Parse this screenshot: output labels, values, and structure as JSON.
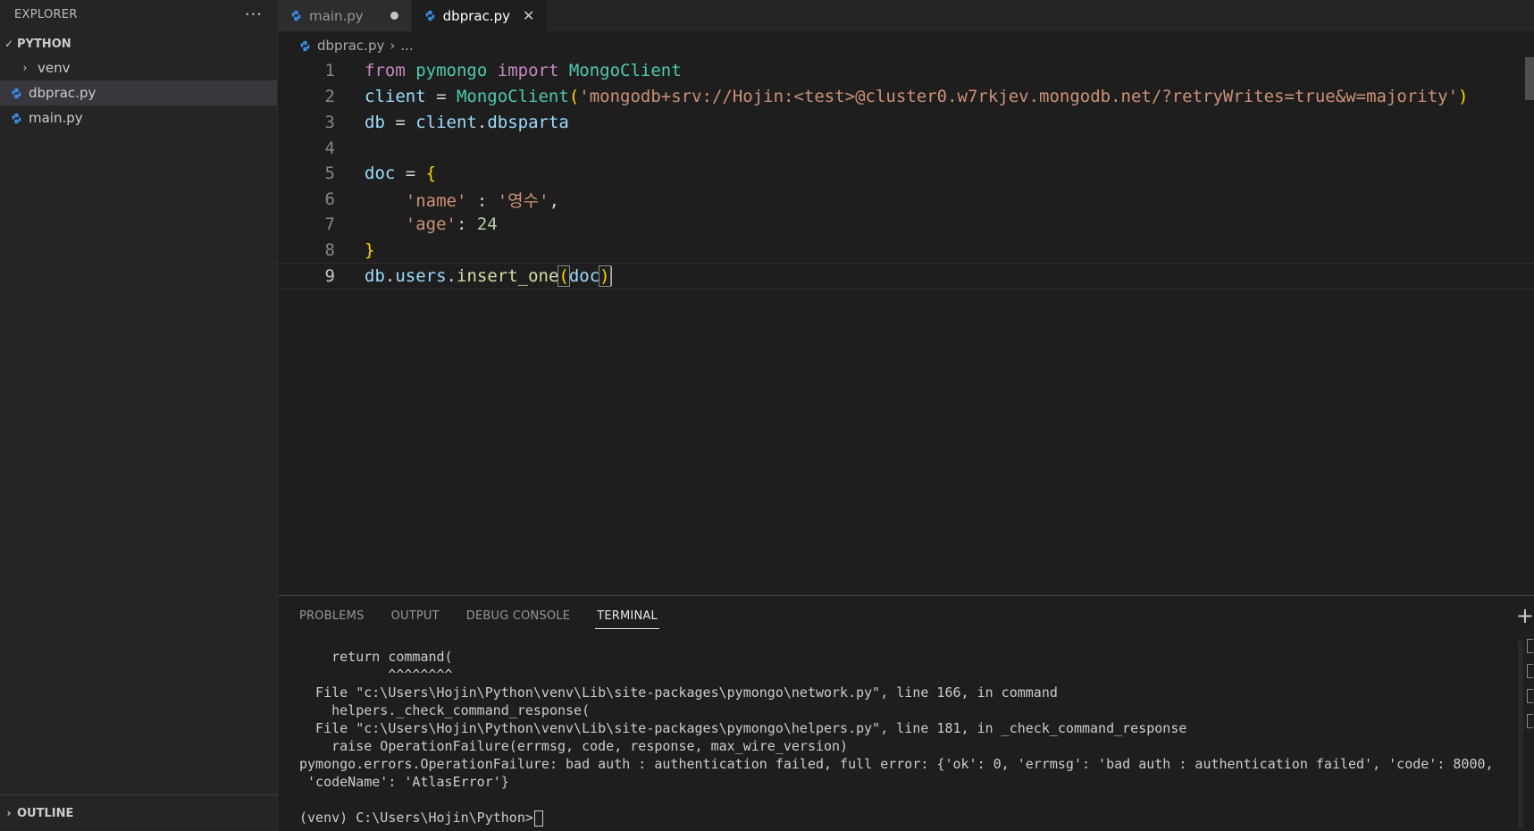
{
  "sidebar": {
    "header": "EXPLORER",
    "more_icon": "ellipsis-icon",
    "section": "PYTHON",
    "items": [
      {
        "label": "venv",
        "type": "folder"
      },
      {
        "label": "dbprac.py",
        "type": "python-file",
        "selected": true
      },
      {
        "label": "main.py",
        "type": "python-file"
      }
    ],
    "outline": "OUTLINE"
  },
  "tabs": [
    {
      "label": "main.py",
      "dirty": true,
      "active": false
    },
    {
      "label": "dbprac.py",
      "dirty": false,
      "active": true
    }
  ],
  "breadcrumb": {
    "file": "dbprac.py",
    "rest": "..."
  },
  "editor": {
    "line_numbers": [
      "1",
      "2",
      "3",
      "4",
      "5",
      "6",
      "7",
      "8",
      "9"
    ],
    "current_line": "9",
    "code": {
      "l1": {
        "from": "from",
        "module": "pymongo",
        "import": "import",
        "cls": "MongoClient"
      },
      "l2": {
        "var": "client",
        "eq": " = ",
        "cls": "MongoClient",
        "open": "(",
        "str": "'mongodb+srv://Hojin:<test>@cluster0.w7rkjev.mongodb.net/?retryWrites=true&w=majority'",
        "close": ")"
      },
      "l3": {
        "var": "db",
        "eq": " = ",
        "obj": "client",
        "dot": ".",
        "attr": "dbsparta"
      },
      "l5": {
        "var": "doc",
        "eq": " = ",
        "open": "{"
      },
      "l6": {
        "key": "'name'",
        "sep": " : ",
        "val": "'영수'",
        "comma": ","
      },
      "l7": {
        "key": "'age'",
        "sep": ": ",
        "val": "24"
      },
      "l8": {
        "close": "}"
      },
      "l9": {
        "obj": "db",
        "dot1": ".",
        "attr": "users",
        "dot2": ".",
        "fn": "insert_one",
        "open": "(",
        "arg": "doc",
        "close": ")"
      }
    }
  },
  "panel": {
    "tabs": [
      "PROBLEMS",
      "OUTPUT",
      "DEBUG CONSOLE",
      "TERMINAL"
    ],
    "active_tab": "TERMINAL",
    "plus_icon": "plus-icon",
    "terminal_lines": [
      "    return command(",
      "           ^^^^^^^^",
      "  File \"c:\\Users\\Hojin\\Python\\venv\\Lib\\site-packages\\pymongo\\network.py\", line 166, in command",
      "    helpers._check_command_response(",
      "  File \"c:\\Users\\Hojin\\Python\\venv\\Lib\\site-packages\\pymongo\\helpers.py\", line 181, in _check_command_response",
      "    raise OperationFailure(errmsg, code, response, max_wire_version)",
      "pymongo.errors.OperationFailure: bad auth : authentication failed, full error: {'ok': 0, 'errmsg': 'bad auth : authentication failed', 'code': 8000,",
      " 'codeName': 'AtlasError'}",
      "",
      "(venv) C:\\Users\\Hojin\\Python>"
    ]
  },
  "colors": {
    "background": "#1e1e1e",
    "sidebar": "#252526",
    "keyword": "#c586c0",
    "class": "#4ec9b0",
    "variable": "#9cdcfe",
    "string": "#ce9178",
    "number": "#b5cea8",
    "function": "#dcdcaa",
    "python_icon": "#3b8eea"
  }
}
